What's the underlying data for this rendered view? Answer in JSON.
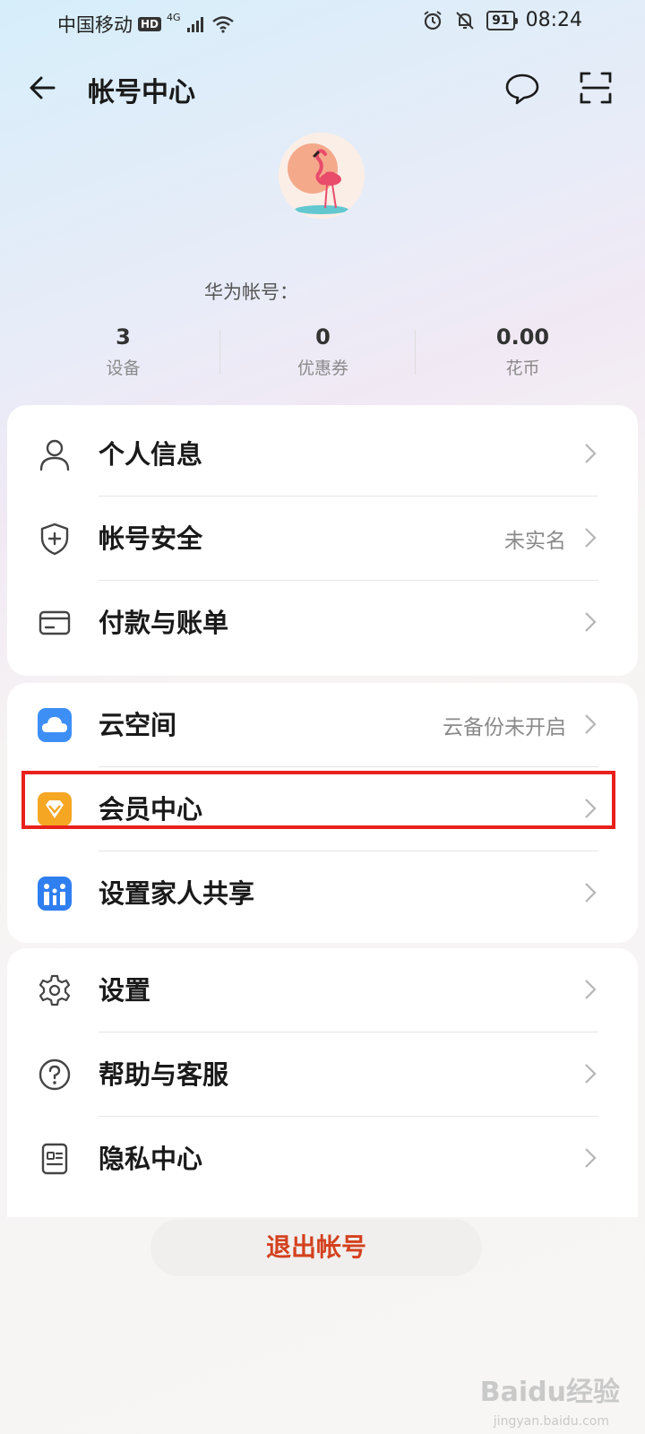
{
  "status_bar": {
    "carrier": "中国移动",
    "hd": "HD",
    "network": "4G",
    "battery": "91",
    "time": "08:24"
  },
  "header": {
    "title": "帐号中心",
    "back_icon": "arrow-left-icon",
    "message_icon": "chat-bubble-icon",
    "scan_icon": "scan-icon"
  },
  "profile": {
    "account_label": "华为帐号："
  },
  "stats": [
    {
      "value": "3",
      "label": "设备"
    },
    {
      "value": "0",
      "label": "优惠券"
    },
    {
      "value": "0.00",
      "label": "花币"
    }
  ],
  "menu": {
    "group1": [
      {
        "label": "个人信息",
        "value": "",
        "icon": "person-icon"
      },
      {
        "label": "帐号安全",
        "value": "未实名",
        "icon": "shield-icon"
      },
      {
        "label": "付款与账单",
        "value": "",
        "icon": "card-icon"
      }
    ],
    "group2": [
      {
        "label": "云空间",
        "value": "云备份未开启",
        "icon": "cloud-icon"
      },
      {
        "label": "会员中心",
        "value": "",
        "icon": "diamond-icon"
      },
      {
        "label": "设置家人共享",
        "value": "",
        "icon": "family-icon"
      }
    ],
    "group3": [
      {
        "label": "设置",
        "value": "",
        "icon": "gear-icon"
      },
      {
        "label": "帮助与客服",
        "value": "",
        "icon": "help-icon"
      },
      {
        "label": "隐私中心",
        "value": "",
        "icon": "privacy-icon"
      }
    ]
  },
  "logout_label": "退出帐号",
  "watermark": {
    "text": "Baidu经验",
    "sub": "jingyan.baidu.com"
  },
  "colors": {
    "accent_red": "#d4411e",
    "highlight": "#e8201c",
    "cloud_blue": "#3d8ff5",
    "vip_gold": "#f5a623"
  }
}
